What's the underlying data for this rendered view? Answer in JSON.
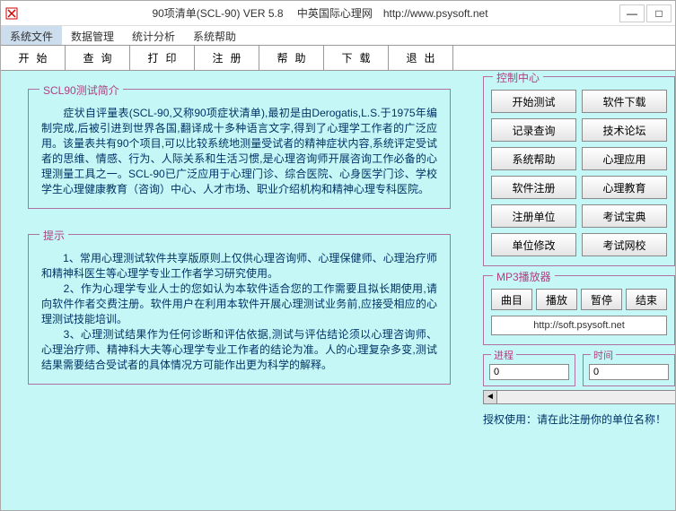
{
  "titlebar": {
    "title": "90项清单(SCL-90) VER 5.8 　中英国际心理网　http://www.psysoft.net"
  },
  "menu": {
    "items": [
      "系统文件",
      "数据管理",
      "统计分析",
      "系统帮助"
    ]
  },
  "toolbar": {
    "items": [
      "开始",
      "查询",
      "打印",
      "注册",
      "帮助",
      "下载",
      "退出"
    ]
  },
  "intro": {
    "title": "SCL90测试简介",
    "text": "　　症状自评量表(SCL-90,又称90项症状清单),最初是由Derogatis,L.S.于1975年编制完成,后被引进到世界各国,翻译成十多种语言文字,得到了心理学工作者的广泛应用。该量表共有90个项目,可以比较系统地测量受试者的精神症状内容,系统评定受试者的思维、情感、行为、人际关系和生活习惯,是心理咨询师开展咨询工作必备的心理测量工具之一。SCL-90已广泛应用于心理门诊、综合医院、心身医学门诊、学校学生心理健康教育（咨询）中心、人才市场、职业介绍机构和精神心理专科医院。"
  },
  "tips": {
    "title": "提示",
    "text": "　　1、常用心理测试软件共享版原则上仅供心理咨询师、心理保健师、心理治疗师和精神科医生等心理学专业工作者学习研究使用。\n　　2、作为心理学专业人士的您如认为本软件适合您的工作需要且拟长期使用,请向软件作者交费注册。软件用户在利用本软件开展心理测试业务前,应接受相应的心理测试技能培训。\n　　3、心理测试结果作为任何诊断和评估依据,测试与评估结论须以心理咨询师、心理治疗师、精神科大夫等心理学专业工作者的结论为准。人的心理复杂多变,测试结果需要结合受试者的具体情况方可能作出更为科学的解释。"
  },
  "control": {
    "title": "控制中心",
    "buttons": [
      [
        "开始测试",
        "软件下载"
      ],
      [
        "记录查询",
        "技术论坛"
      ],
      [
        "系统帮助",
        "心理应用"
      ],
      [
        "软件注册",
        "心理教育"
      ],
      [
        "注册单位",
        "考试宝典"
      ],
      [
        "单位修改",
        "考试网校"
      ]
    ]
  },
  "mp3": {
    "title": "MP3播放器",
    "buttons": [
      "曲目",
      "播放",
      "暂停",
      "结束"
    ],
    "url": "http://soft.psysoft.net"
  },
  "progress": {
    "title": "进程",
    "value": "0"
  },
  "time": {
    "title": "时间",
    "value": "0"
  },
  "auth": {
    "text": "授权使用：请在此注册你的单位名称！"
  }
}
